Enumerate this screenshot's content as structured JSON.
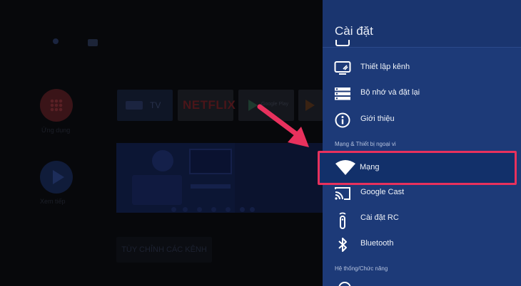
{
  "home": {
    "netflix_label": "NETFLIX",
    "tv_label": "TV",
    "google_play_label": "Google Play",
    "customize_channels_label": "TÙY CHỈNH CÁC KÊNH"
  },
  "panel": {
    "title": "Cài đặt",
    "items": [
      {
        "label": "Thiết lập kênh",
        "icon": "tv-settings-icon"
      },
      {
        "label": "Bộ nhớ và đặt lại",
        "icon": "storage-icon"
      },
      {
        "label": "Giới thiệu",
        "icon": "info-icon"
      }
    ],
    "section_network": "Mạng & Thiết bị ngoại vi",
    "network_items": [
      {
        "label": "Mạng",
        "icon": "wifi-icon",
        "selected": true
      },
      {
        "label": "Google Cast",
        "icon": "cast-icon"
      },
      {
        "label": "Cài đặt RC",
        "icon": "remote-icon"
      },
      {
        "label": "Bluetooth",
        "icon": "bluetooth-icon"
      }
    ],
    "section_system": "Hệ thống/Chức năng"
  },
  "colors": {
    "panel_bg": "#1d3a78",
    "highlight_border": "#e8315d",
    "arrow": "#e8315d",
    "text": "#eef2f8"
  }
}
